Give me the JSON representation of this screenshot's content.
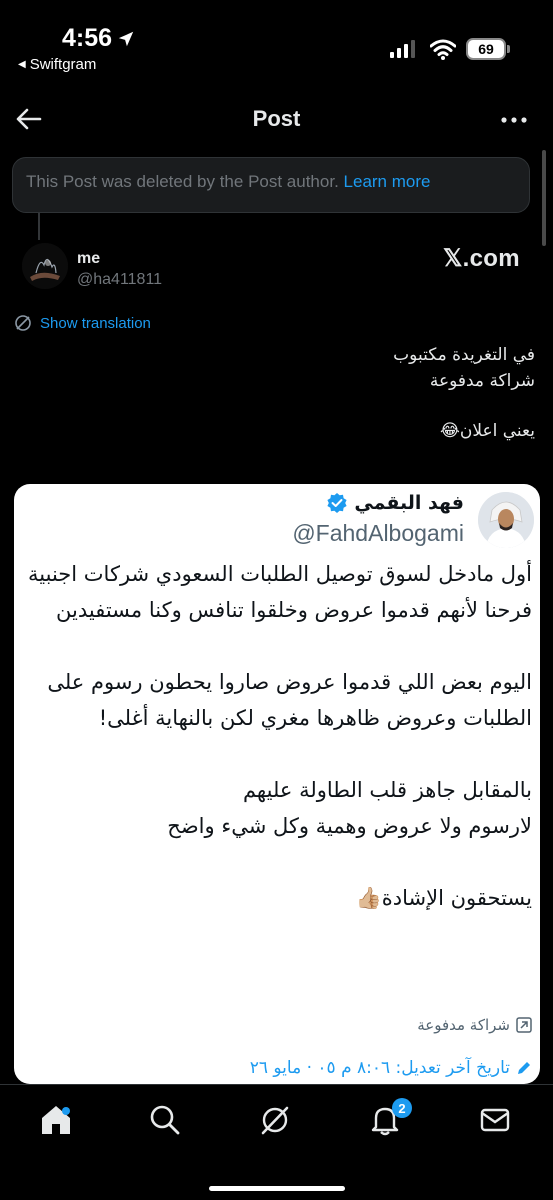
{
  "status_bar": {
    "time": "4:56",
    "back_app": "Swiftgram",
    "battery": "69"
  },
  "header": {
    "title": "Post"
  },
  "deleted_notice": {
    "text": "This Post was deleted by the Post author.",
    "link": "Learn more"
  },
  "post": {
    "author_name": "me",
    "author_handle": "@ha411811",
    "source_label": "𝕏.com",
    "show_translation": "Show translation",
    "lines": [
      "في التغريدة مكتبوب",
      "شراكة مدفوعة",
      "يعني اعلان😂"
    ]
  },
  "embedded": {
    "name": "فهد البقمي",
    "handle": "@FahdAlbogami",
    "lines": [
      "أول مادخل لسوق توصيل الطلبات السعودي شركات اجنبية",
      "فرحنا لأنهم قدموا عروض وخلقوا تنافس وكنا مستفيدين",
      "اليوم بعض اللي قدموا عروض صاروا يحطون رسوم على",
      "الطلبات وعروض ظاهرها مغري لكن بالنهاية أغلى!",
      "بالمقابل جاهز قلب الطاولة عليهم",
      "لارسوم ولا عروض وهمية وكل شيء واضح",
      "يستحقون الإشادة👍🏼"
    ],
    "paid_label": "شراكة مدفوعة",
    "edited_label": "تاريخ آخر تعديل: ٨:٠٦ م ٠٥ · مايو ٢٦"
  },
  "bottom_nav": {
    "notification_count": "2"
  },
  "colors": {
    "accent": "#1d9bf0",
    "background": "#000000",
    "muted": "#71767b"
  }
}
